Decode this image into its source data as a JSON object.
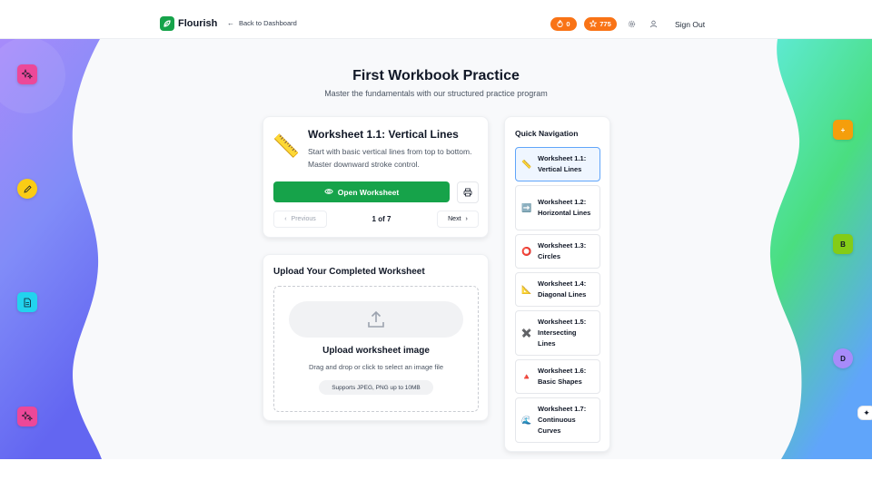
{
  "header": {
    "brand": "Flourish",
    "back_label": "Back to Dashboard",
    "streak_count": "0",
    "points_count": "775",
    "sign_out": "Sign Out"
  },
  "page": {
    "title": "First Workbook Practice",
    "subtitle": "Master the fundamentals with our structured practice program"
  },
  "worksheet": {
    "icon": "📏",
    "title": "Worksheet 1.1: Vertical Lines",
    "description": "Start with basic vertical lines from top to bottom. Master downward stroke control.",
    "open_label": "Open Worksheet",
    "prev_label": "Previous",
    "page_indicator": "1 of 7",
    "next_label": "Next"
  },
  "upload": {
    "section_title": "Upload Your Completed Worksheet",
    "drop_title": "Upload worksheet image",
    "drop_subtitle": "Drag and drop or click to select an image file",
    "formats": "Supports JPEG, PNG up to 10MB"
  },
  "quick_nav": {
    "title": "Quick Navigation",
    "items": [
      {
        "icon": "📏",
        "label": "Worksheet 1.1: Vertical Lines",
        "active": true
      },
      {
        "icon": "➡️",
        "label": "Worksheet 1.2: Horizontal Lines",
        "active": false
      },
      {
        "icon": "⭕",
        "label": "Worksheet 1.3: Circles",
        "active": false
      },
      {
        "icon": "📐",
        "label": "Worksheet 1.4: Diagonal Lines",
        "active": false
      },
      {
        "icon": "✖️",
        "label": "Worksheet 1.5: Intersecting Lines",
        "active": false
      },
      {
        "icon": "🔺",
        "label": "Worksheet 1.6: Basic Shapes",
        "active": false
      },
      {
        "icon": "🌊",
        "label": "Worksheet 1.7: Continuous Curves",
        "active": false
      }
    ]
  },
  "decor": {
    "left_letters": [],
    "right_tiles": [
      "+",
      "B",
      "D"
    ]
  },
  "colors": {
    "brand_green": "#16a34a",
    "badge_orange": "#f97316",
    "active_border": "#60a5fa"
  }
}
